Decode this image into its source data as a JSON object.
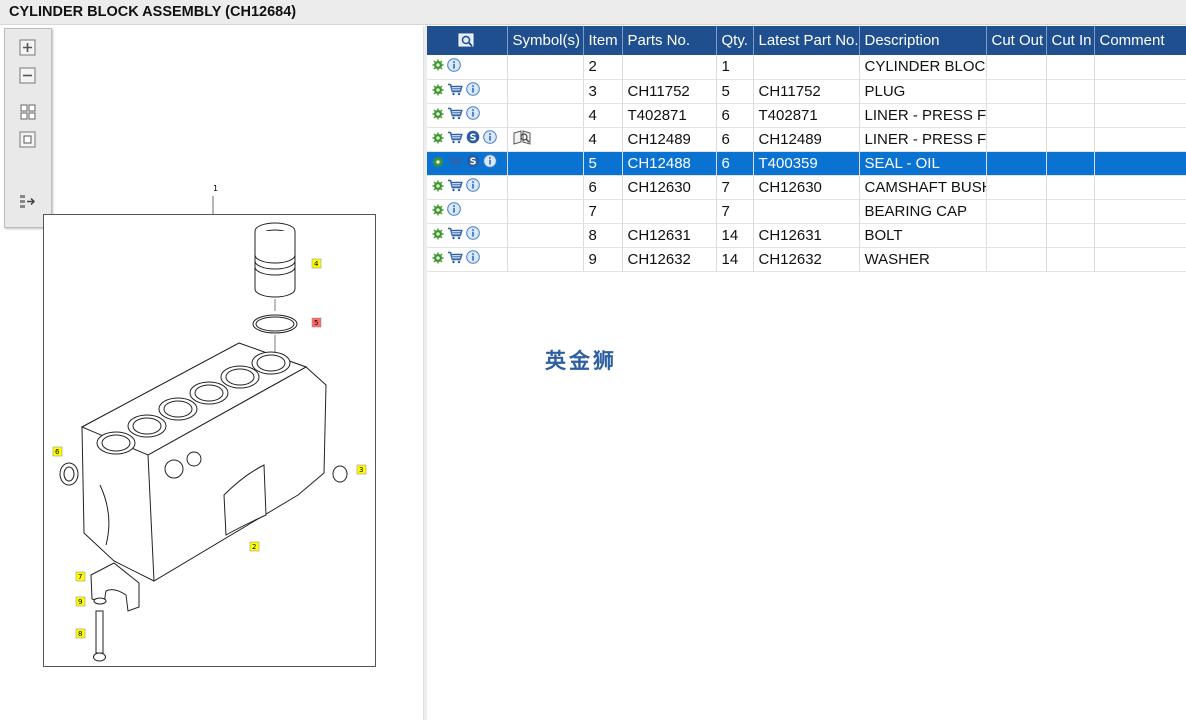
{
  "window": {
    "title": "CYLINDER BLOCK ASSEMBLY (CH12684)"
  },
  "toolbox": {
    "buttons": [
      {
        "icon": "zoom-in-icon"
      },
      {
        "icon": "zoom-out-icon"
      },
      {
        "icon": "fit-all-icon"
      },
      {
        "icon": "fit-window-icon"
      },
      {
        "icon": "export-icon"
      }
    ]
  },
  "drawing": {
    "callouts": [
      "1",
      "4",
      "5",
      "6",
      "3",
      "2",
      "7",
      "9",
      "8"
    ],
    "highlight_color": "#ffff00",
    "selected_color": "#ff5555"
  },
  "watermark": "英金狮",
  "table": {
    "columns": [
      "",
      "Symbol(s)",
      "Item",
      "Parts No.",
      "Qty.",
      "Latest Part No.",
      "Description",
      "Cut Out",
      "Cut In",
      "Comment"
    ],
    "rows": [
      {
        "icons": [
          "gear",
          "info"
        ],
        "symbol": "",
        "item": "2",
        "parts_no": "",
        "qty": "1",
        "latest": "",
        "description": "CYLINDER BLOCK",
        "selected": false
      },
      {
        "icons": [
          "gear",
          "cart",
          "info"
        ],
        "symbol": "",
        "item": "3",
        "parts_no": "CH11752",
        "qty": "5",
        "latest": "CH11752",
        "description": "PLUG",
        "selected": false
      },
      {
        "icons": [
          "gear",
          "cart",
          "info"
        ],
        "symbol": "",
        "item": "4",
        "parts_no": "T402871",
        "qty": "6",
        "latest": "T402871",
        "description": "LINER - PRESS FIT",
        "selected": false
      },
      {
        "icons": [
          "gear",
          "cart",
          "s",
          "info"
        ],
        "symbol": "book",
        "item": "4",
        "parts_no": "CH12489",
        "qty": "6",
        "latest": "CH12489",
        "description": "LINER - PRESS FIT",
        "selected": false
      },
      {
        "icons": [
          "gear",
          "cart",
          "s",
          "info"
        ],
        "symbol": "",
        "item": "5",
        "parts_no": "CH12488",
        "qty": "6",
        "latest": "T400359",
        "description": "SEAL - OIL",
        "selected": true
      },
      {
        "icons": [
          "gear",
          "cart",
          "info"
        ],
        "symbol": "",
        "item": "6",
        "parts_no": "CH12630",
        "qty": "7",
        "latest": "CH12630",
        "description": "CAMSHAFT BUSH",
        "selected": false
      },
      {
        "icons": [
          "gear",
          "info"
        ],
        "symbol": "",
        "item": "7",
        "parts_no": "",
        "qty": "7",
        "latest": "",
        "description": "BEARING CAP",
        "selected": false
      },
      {
        "icons": [
          "gear",
          "cart",
          "info"
        ],
        "symbol": "",
        "item": "8",
        "parts_no": "CH12631",
        "qty": "14",
        "latest": "CH12631",
        "description": "BOLT",
        "selected": false
      },
      {
        "icons": [
          "gear",
          "cart",
          "info"
        ],
        "symbol": "",
        "item": "9",
        "parts_no": "CH12632",
        "qty": "14",
        "latest": "CH12632",
        "description": "WASHER",
        "selected": false
      }
    ]
  },
  "colors": {
    "header_bg": "#1f4f8f",
    "selected_bg": "#0a73d2",
    "gear": "#3f9a2a",
    "info": "#3d7cc9"
  }
}
